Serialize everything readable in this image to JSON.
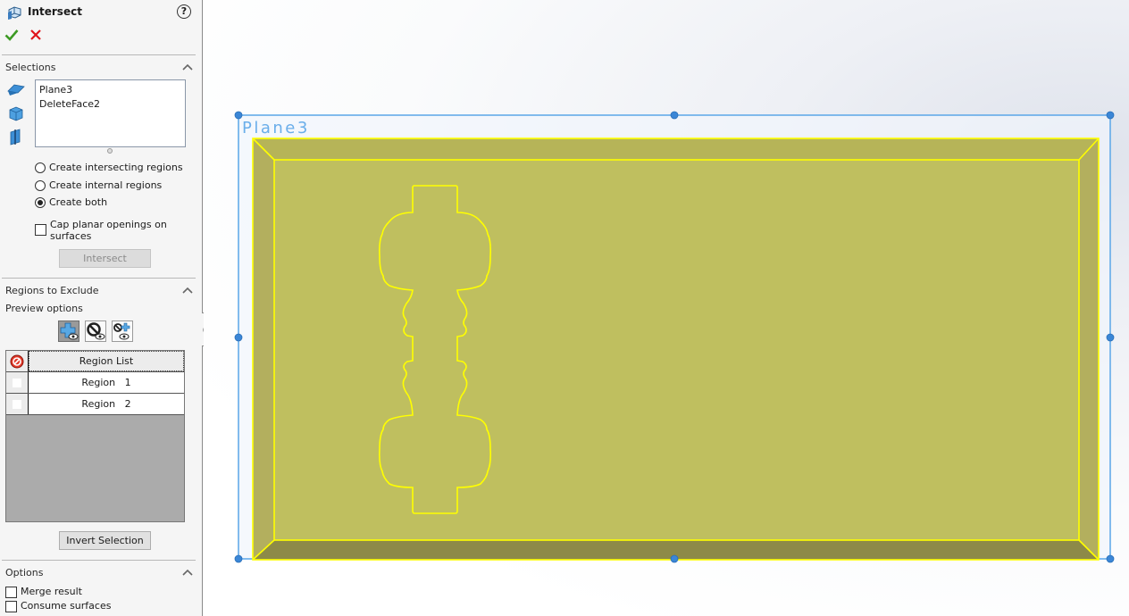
{
  "panel": {
    "title": "Intersect",
    "icons": {
      "feature": "intersect-feature-icon",
      "help": "help-icon",
      "ok": "checkmark-icon",
      "cancel": "close-icon",
      "help_glyph": "?"
    },
    "selections": {
      "title": "Selections",
      "items": [
        "Plane3",
        "DeleteFace2"
      ],
      "radio_options": [
        {
          "label": "Create intersecting regions",
          "selected": false
        },
        {
          "label": "Create internal regions",
          "selected": false
        },
        {
          "label": "Create both",
          "selected": true
        }
      ],
      "cap_planar_label_line1": "Cap planar openings on",
      "cap_planar_label_line2": "surfaces",
      "cap_planar_checked": false,
      "intersect_button": "Intersect"
    },
    "regions_to_exclude": {
      "title": "Regions to Exclude",
      "preview_options_label": "Preview options",
      "preview_buttons": [
        "include-preview",
        "exclude-preview",
        "both-preview"
      ],
      "table_header": "Region List",
      "regions": [
        {
          "label": "Region   1",
          "excluded": false
        },
        {
          "label": "Region   2",
          "excluded": false
        }
      ],
      "invert_button": "Invert Selection"
    },
    "options": {
      "title": "Options",
      "merge_result": {
        "label": "Merge result",
        "checked": false
      },
      "consume_surfaces": {
        "label": "Consume surfaces",
        "checked": false
      }
    }
  },
  "viewport": {
    "plane_label": "Plane3",
    "colors": {
      "plane_border": "#5aa6e8",
      "handle": "#3b86d6",
      "face_fill": "#bfbf5f",
      "bevel_top": "#b6b458",
      "bevel_side": "#b3af5e",
      "bevel_bottom": "#8d8a48",
      "edge": "#ffff00"
    }
  }
}
